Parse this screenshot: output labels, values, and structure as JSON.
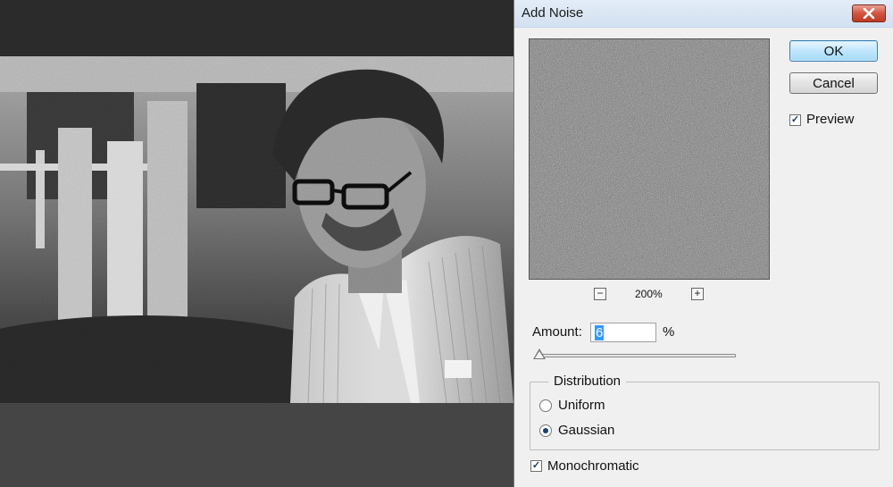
{
  "dialog": {
    "title": "Add Noise",
    "ok_label": "OK",
    "cancel_label": "Cancel",
    "preview_label": "Preview",
    "preview_checked": true,
    "zoom_level": "200%",
    "zoom_out_symbol": "−",
    "zoom_in_symbol": "+",
    "amount_label": "Amount:",
    "amount_value": "6",
    "amount_unit": "%",
    "distribution": {
      "title": "Distribution",
      "options": [
        {
          "label": "Uniform",
          "selected": false
        },
        {
          "label": "Gaussian",
          "selected": true
        }
      ]
    },
    "monochromatic_label": "Monochromatic",
    "monochromatic_checked": true,
    "close_icon": "close-icon",
    "colors": {
      "titlebar": "#d3e1f1",
      "close_button": "#c23a22",
      "ok_button": "#bee6fd",
      "dialog_bg": "#f0f0f0"
    }
  }
}
